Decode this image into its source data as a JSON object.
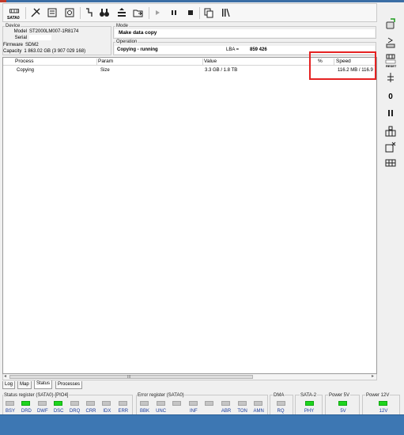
{
  "toolbar": {
    "sata_label": "SATA0",
    "buttons": [
      {
        "icon": "sata-port-icon"
      },
      {
        "icon": "tools-icon"
      },
      {
        "icon": "chip-info-icon"
      },
      {
        "icon": "drive-info-icon"
      },
      {
        "icon": "probe-icon"
      },
      {
        "icon": "binoculars-icon"
      },
      {
        "icon": "copy-stack-icon"
      },
      {
        "icon": "folder-arrow-icon"
      },
      {
        "icon": "play-icon"
      },
      {
        "icon": "pause-icon"
      },
      {
        "icon": "stop-icon"
      },
      {
        "icon": "copy-pages-icon"
      },
      {
        "icon": "tally-icon"
      }
    ]
  },
  "device": {
    "group_label": "Device",
    "model_key": "Model",
    "model": "ST2000LM007-1R8174",
    "serial_key": "Serial",
    "serial": "",
    "firmware_key": "Firmware",
    "firmware": "SDM2",
    "capacity_key": "Capacity",
    "capacity": "1 863.02 GB (3 907 029 168)"
  },
  "mode": {
    "group_label": "Mode",
    "value": "Make data copy"
  },
  "operation": {
    "group_label": "Operation",
    "value": "Copying - running",
    "lba_label": "LBA =",
    "lba_value": "859 426"
  },
  "table": {
    "columns": [
      "Process",
      "Param",
      "Value",
      "%",
      "Speed"
    ],
    "rows": [
      {
        "process": "Copying",
        "param": "Size",
        "value": "3.3 GB / 1.8 TB",
        "percent": "",
        "speed": "116.2 MB / 116.9 M"
      }
    ]
  },
  "scroll": {
    "thumb_marker": "III"
  },
  "tabs": [
    {
      "label": "Log",
      "active": false
    },
    {
      "label": "Map",
      "active": false
    },
    {
      "label": "Status",
      "active": true
    },
    {
      "label": "Processes",
      "active": false
    }
  ],
  "status_register": {
    "label": "Status register (SATA0)-[PIO4]",
    "leds": [
      {
        "name": "BSY",
        "on": false
      },
      {
        "name": "DRD",
        "on": true
      },
      {
        "name": "DWF",
        "on": false
      },
      {
        "name": "DSC",
        "on": true
      },
      {
        "name": "DRQ",
        "on": false
      },
      {
        "name": "CRR",
        "on": false
      },
      {
        "name": "IDX",
        "on": false
      },
      {
        "name": "ERR",
        "on": false
      }
    ]
  },
  "error_register": {
    "label": "Error register (SATA0)",
    "leds": [
      {
        "name": "BBK",
        "on": false
      },
      {
        "name": "UNC",
        "on": false
      },
      {
        "name": "",
        "on": false
      },
      {
        "name": "INF",
        "on": false
      },
      {
        "name": "",
        "on": false
      },
      {
        "name": "ABR",
        "on": false
      },
      {
        "name": "TON",
        "on": false
      },
      {
        "name": "AMN",
        "on": false
      }
    ]
  },
  "dma": {
    "label": "DMA",
    "led": "RQ",
    "on": false
  },
  "sata2": {
    "label": "SATA-2",
    "led": "PHY",
    "on": true
  },
  "power5": {
    "label": "Power 5V",
    "led": "5V",
    "on": true
  },
  "power12": {
    "label": "Power 12V",
    "led": "12V",
    "on": true
  },
  "rightbar": {
    "items": [
      {
        "icon": "drive-plug-icon"
      },
      {
        "icon": "drive-arrow-icon"
      },
      {
        "icon": "reset-icon",
        "label": "RESET"
      },
      {
        "icon": "voltage-icon"
      },
      {
        "icon": "zero-indicator-icon",
        "label": "0"
      },
      {
        "icon": "pause-icon"
      },
      {
        "icon": "grid-lock-icon"
      },
      {
        "icon": "window-close-icon"
      },
      {
        "icon": "grid-arrows-icon"
      }
    ]
  },
  "colors": {
    "highlight": "#e52222",
    "led_on": "#1ed51e",
    "led_off": "#c5c5c5",
    "taskbar": "#3d77b3"
  }
}
